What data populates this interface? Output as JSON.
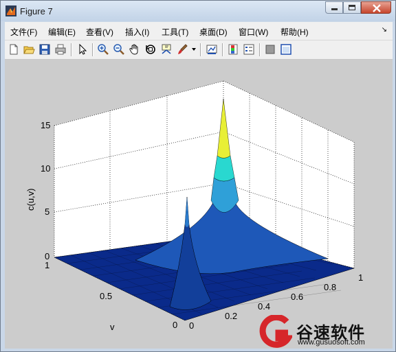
{
  "window": {
    "title": "Figure 7"
  },
  "menu": [
    "文件(F)",
    "编辑(E)",
    "查看(V)",
    "插入(I)",
    "工具(T)",
    "桌面(D)",
    "窗口(W)",
    "帮助(H)"
  ],
  "toolbar": [
    "new-figure-icon",
    "open-file-icon",
    "save-icon",
    "print-icon",
    "select-arrow-icon",
    "zoom-in-icon",
    "zoom-out-icon",
    "pan-hand-icon",
    "rotate-3d-icon",
    "data-cursor-icon",
    "brush-icon",
    "brush-dropdown-icon",
    "link-plot-icon",
    "colorbar-icon",
    "legend-icon",
    "hide-plot-tools-icon",
    "show-plot-tools-icon"
  ],
  "plot": {
    "zlabel": "c(u,v)",
    "ylabel": "v",
    "z_ticks": [
      "0",
      "5",
      "10",
      "15"
    ],
    "y_ticks": [
      "0",
      "0.5",
      "1"
    ],
    "x_ticks": [
      "0",
      "0.2",
      "0.4",
      "0.6",
      "0.8",
      "1"
    ]
  },
  "watermark": {
    "name": "谷速软件",
    "url": "www.gusuosoft.com"
  }
}
